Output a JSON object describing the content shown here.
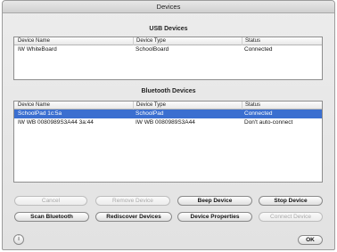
{
  "window": {
    "title": "Devices"
  },
  "usb": {
    "title": "USB Devices",
    "columns": [
      "Device Name",
      "Device Type",
      "Status"
    ],
    "rows": [
      {
        "name": "IW WhiteBoard",
        "type": "SchoolBoard",
        "status": "Connected"
      }
    ]
  },
  "bluetooth": {
    "title": "Bluetooth Devices",
    "columns": [
      "Device Name",
      "Device Type",
      "Status"
    ],
    "rows": [
      {
        "name": "SchoolPad 1c:5a",
        "type": "SchoolPad",
        "status": "Connected",
        "selected": true
      },
      {
        "name": "IW WB 0080989S3A44 3a:44",
        "type": "IW WB 0080989S3A44",
        "status": "Don't auto-connect",
        "selected": false
      }
    ]
  },
  "buttons": {
    "cancel": "Cancel",
    "remove_device": "Remove Device",
    "beep_device": "Beep Device",
    "stop_device": "Stop Device",
    "scan_bluetooth": "Scan Bluetooth",
    "rediscover_devices": "Rediscover Devices",
    "device_properties": "Device Properties",
    "connect_device": "Connect Device",
    "ok": "OK"
  },
  "help": {
    "icon": "help-icon",
    "glyph": "i"
  },
  "colors": {
    "selection": "#3b6fd0"
  }
}
